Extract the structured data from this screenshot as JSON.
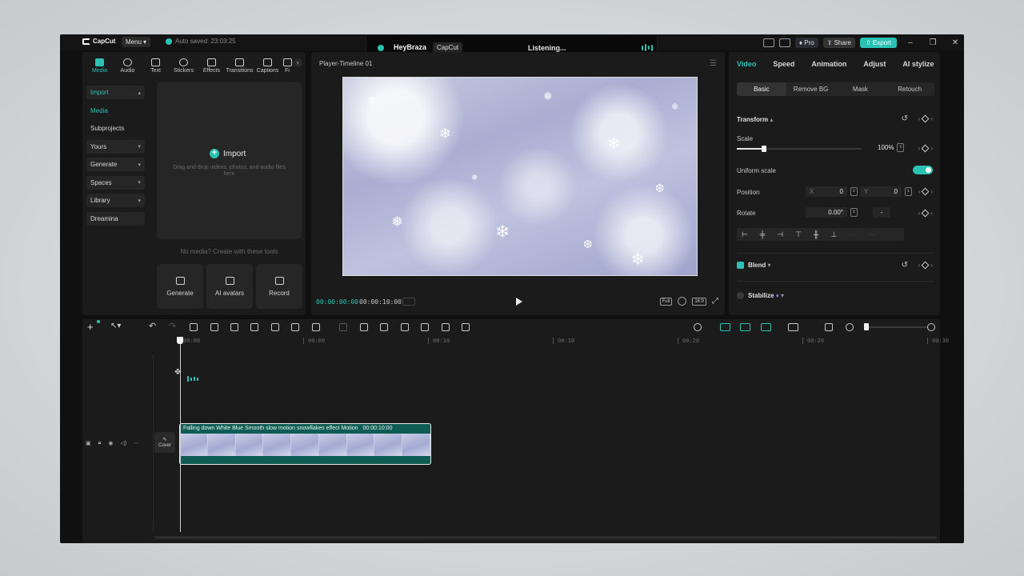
{
  "titlebar": {
    "app_name": "CapCut",
    "menu_label": "Menu",
    "autosave_text": "Auto saved: 23:03:25",
    "pro_label": "Pro",
    "share_label": "Share",
    "export_label": "Export"
  },
  "assistant": {
    "name": "HeyBraza",
    "tag": "CapCut",
    "status": "Listening..."
  },
  "media_tabs": [
    {
      "label": "Media",
      "icon": "media-icon"
    },
    {
      "label": "Audio",
      "icon": "audio-icon"
    },
    {
      "label": "Text",
      "icon": "text-icon"
    },
    {
      "label": "Stickers",
      "icon": "stickers-icon"
    },
    {
      "label": "Effects",
      "icon": "effects-icon"
    },
    {
      "label": "Transitions",
      "icon": "transitions-icon"
    },
    {
      "label": "Captions",
      "icon": "captions-icon"
    },
    {
      "label": "Fi",
      "icon": "filters-icon"
    }
  ],
  "side_nav": [
    {
      "label": "Import"
    },
    {
      "label": "Media"
    },
    {
      "label": "Subprojects"
    },
    {
      "label": "Yours"
    },
    {
      "label": "Generate"
    },
    {
      "label": "Spaces"
    },
    {
      "label": "Library"
    },
    {
      "label": "Dreamina"
    }
  ],
  "import_area": {
    "label": "Import",
    "hint": "Drag and drop videos, photos, and audio files here",
    "no_media": "No media? Create with these tools"
  },
  "tools": [
    {
      "label": "Generate"
    },
    {
      "label": "AI avatars"
    },
    {
      "label": "Record"
    }
  ],
  "player": {
    "title": "Player-Timeline 01",
    "current_time": "00:00:00:00",
    "total_time": "00:00:10:00",
    "full_label": "Full",
    "ratio_label": "16:9"
  },
  "inspector": {
    "tabs": [
      "Video",
      "Speed",
      "Animation",
      "Adjust",
      "AI stylize"
    ],
    "sub_tabs": [
      "Basic",
      "Remove BG",
      "Mask",
      "Retouch"
    ],
    "transform_label": "Transform",
    "scale_label": "Scale",
    "scale_value": "100%",
    "scale_fraction": 0.22,
    "uniform_scale_label": "Uniform scale",
    "position_label": "Position",
    "pos_x_label": "X",
    "pos_x": "0",
    "pos_y_label": "Y",
    "pos_y": "0",
    "rotate_label": "Rotate",
    "rotate_value": "0.00°",
    "rotate_extra": "-",
    "blend_label": "Blend",
    "stabilize_label": "Stabilize"
  },
  "timeline": {
    "ruler_labels": [
      "00:00",
      "00:00",
      "00:10",
      "00:10",
      "00:20",
      "00:20",
      "00:30"
    ],
    "clip_title": "Falling down White Blue Smooth slow motion snowflakes effect Motion",
    "clip_duration": "00:00:10:00",
    "cover_label": "Cover"
  },
  "colors": {
    "accent": "#2bc2b5",
    "panel": "#1b1b1b",
    "background": "#101010"
  }
}
